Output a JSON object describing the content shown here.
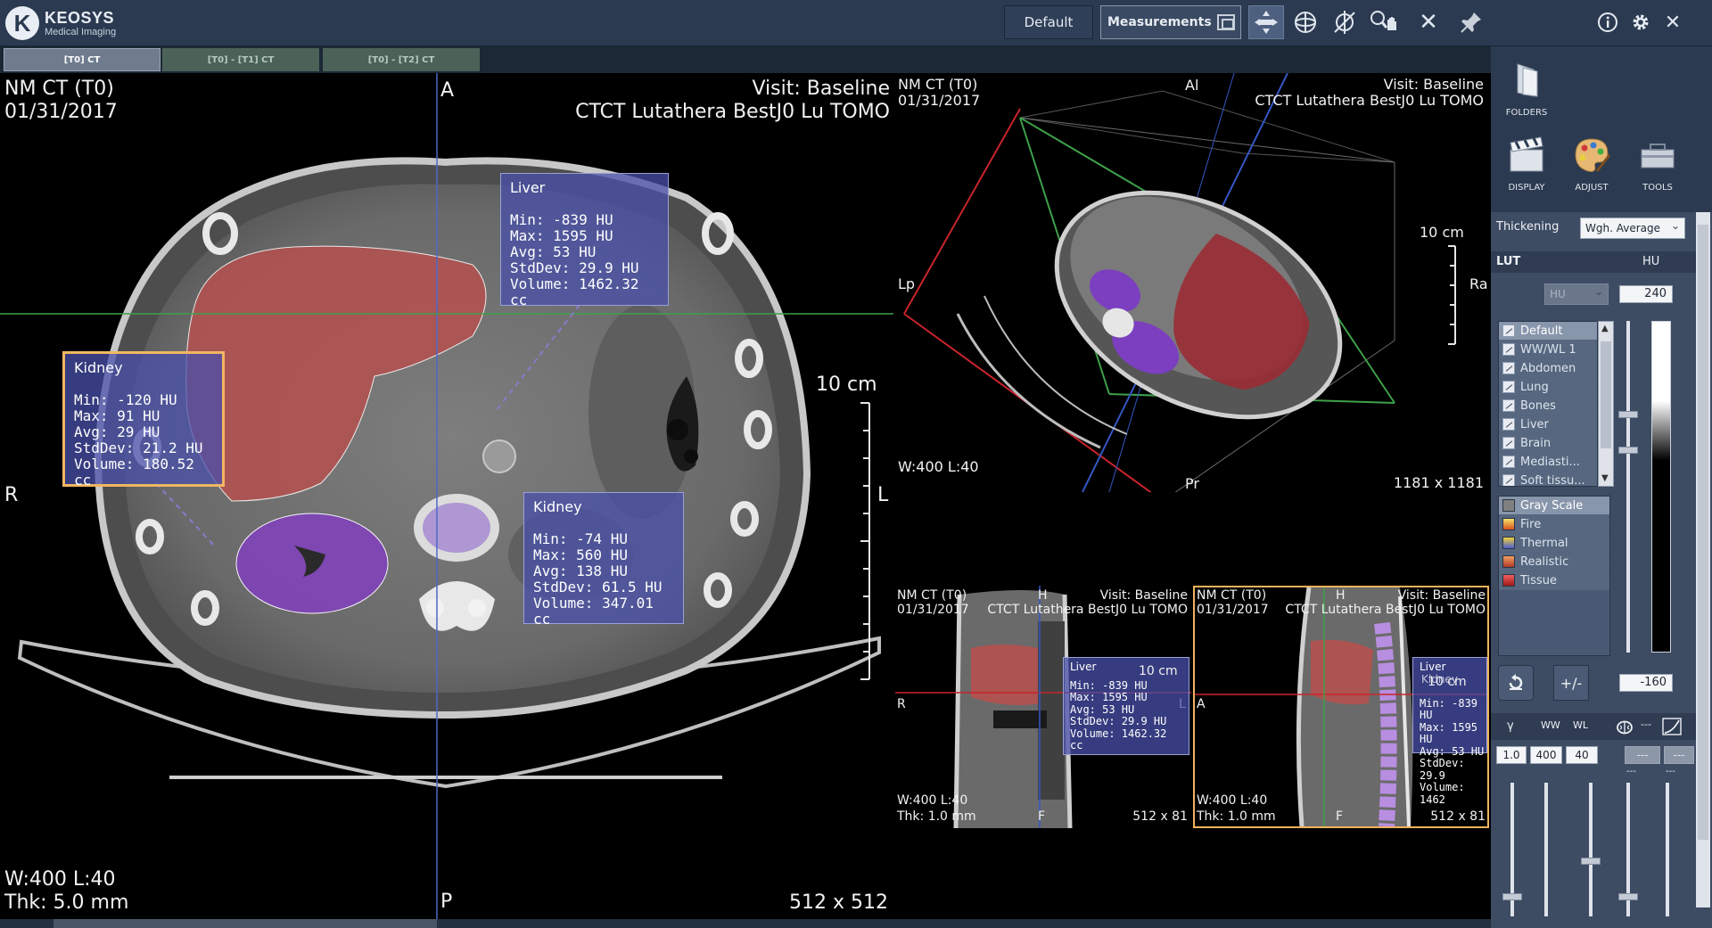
{
  "app": {
    "logo_name": "KEOSYS",
    "logo_sub": "Medical Imaging",
    "layout_button": "Default",
    "measurements_button": "Measurements"
  },
  "tabs": [
    "[T0] CT",
    "[T0] - [T1] CT",
    "[T0] - [T2] CT"
  ],
  "main_view": {
    "series": "NM CT (T0)",
    "date": "01/31/2017",
    "visit": "Visit: Baseline",
    "study": "CTCT Lutathera BestJ0 Lu TOMO",
    "orient_top": "A",
    "orient_bottom": "P",
    "orient_left": "R",
    "orient_right": "L",
    "scale": "10 cm",
    "wl": "W:400   L:40",
    "thk": "Thk: 5.0 mm",
    "matrix": "512 x 512",
    "rois": [
      {
        "title": "Liver",
        "lines": [
          "Min: -839 HU",
          "Max: 1595 HU",
          "Avg: 53 HU",
          "StdDev: 29.9 HU",
          "Volume: 1462.32 cc"
        ]
      },
      {
        "title": "Kidney",
        "lines": [
          "Min: -120 HU",
          "Max: 91 HU",
          "Avg: 29 HU",
          "StdDev: 21.2 HU",
          "Volume: 180.52 cc"
        ]
      },
      {
        "title": "Kidney",
        "lines": [
          "Min: -74 HU",
          "Max: 560 HU",
          "Avg: 138 HU",
          "StdDev: 61.5 HU",
          "Volume: 347.01 cc"
        ]
      }
    ]
  },
  "view_3d": {
    "series": "NM CT (T0)",
    "date": "01/31/2017",
    "visit": "Visit: Baseline",
    "study": "CTCT Lutathera BestJ0 Lu TOMO",
    "orient_top": "Al",
    "orient_bottom": "Pr",
    "orient_left": "Lp",
    "orient_right": "Ra",
    "scale": "10 cm",
    "wl": "W:400   L:40",
    "matrix": "1181 x 1181"
  },
  "view_coronal": {
    "series": "NM CT (T0)",
    "date": "01/31/2017",
    "visit": "Visit: Baseline",
    "study": "CTCT Lutathera BestJ0 Lu TOMO",
    "orient_top": "H",
    "orient_bottom": "F",
    "orient_left": "R",
    "orient_right": "L",
    "scale": "10 cm",
    "wl": "W:400   L:40",
    "thk": "Thk: 1.0 mm",
    "matrix": "512 x 81",
    "roi": {
      "title": "Liver",
      "lines": [
        "Min: -839 HU",
        "Max: 1595 HU",
        "Avg: 53 HU",
        "StdDev: 29.9 HU",
        "Volume: 1462.32 cc"
      ]
    }
  },
  "view_sagittal": {
    "series": "NM CT (T0)",
    "date": "01/31/2017",
    "visit": "Visit: Baseline",
    "study": "CTCT Lutathera BestJ0 Lu TOMO",
    "orient_top": "H",
    "orient_bottom": "F",
    "orient_left": "A",
    "scale": "10 cm",
    "wl": "W:400   L:40",
    "thk": "Thk: 1.0 mm",
    "matrix": "512 x 81",
    "roi_title": "Liver",
    "roi_title2": "Kidney",
    "roi_lines": [
      "Min: -839 HU",
      "Max: 1595 HU",
      "Avg: 53 HU",
      "StdDev: 29.9",
      "Volume: 1462"
    ]
  },
  "panel": {
    "folders": "FOLDERS",
    "display": "DISPLAY",
    "adjust": "ADJUST",
    "tools": "TOOLS",
    "thickening_label": "Thickening",
    "thickening_value": "Wgh. Average",
    "lut_label": "LUT",
    "hu_label": "HU",
    "hu_select": "HU",
    "hu_max": "240",
    "hu_min": "-160",
    "presets": [
      "Default",
      "WW/WL 1",
      "Abdomen",
      "Lung",
      "Bones",
      "Liver",
      "Brain",
      "Mediasti...",
      "Soft tissu..."
    ],
    "palettes": [
      {
        "name": "Gray Scale",
        "color": "#808080"
      },
      {
        "name": "Fire",
        "color": "#e8a020"
      },
      {
        "name": "Thermal",
        "color": "#5060d0"
      },
      {
        "name": "Realistic",
        "color": "#c85030"
      },
      {
        "name": "Tissue",
        "color": "#d83030"
      }
    ],
    "invert_label": "+/-",
    "col_gamma": "γ",
    "col_ww": "WW",
    "col_wl": "WL",
    "col_dash": "---",
    "gamma_value": "1.0",
    "ww_value": "400",
    "wl_value": "40",
    "dash_value": "---",
    "dash_value2": "---",
    "dash_small": "---"
  }
}
